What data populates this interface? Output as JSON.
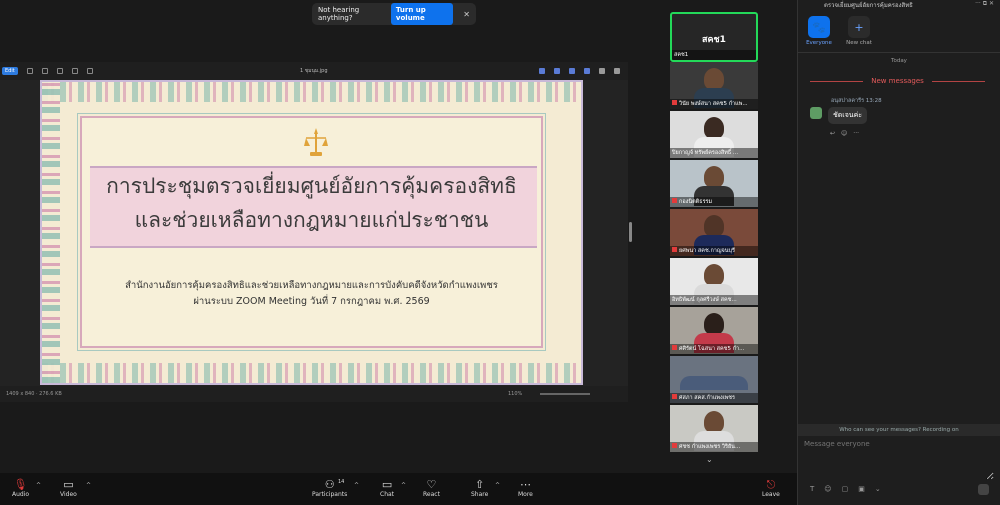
{
  "banner": {
    "text": "Not hearing anything?",
    "button": "Turn up volume"
  },
  "share": {
    "toolbar_edit": "Edit",
    "toolbar_title": "1 ชุมนุม.jpg",
    "status": "1409 x 840 · 276.6 KB",
    "zoom": "110%"
  },
  "slide": {
    "title_line1": "การประชุมตรวจเยี่ยมศูนย์อัยการคุ้มครองสิทธิ",
    "title_line2": "และช่วยเหลือทางกฎหมายแก่ประชาชน",
    "subtitle_line1": "สำนักงานอัยการคุ้มครองสิทธิและช่วยเหลือทางกฎหมายและการบังคับคดีจังหวัดกำแพงเพชร",
    "subtitle_line2": "ผ่านระบบ ZOOM  Meeting วันที่ 7 กรกฎาคม พ.ศ. 2569"
  },
  "participants": [
    {
      "big": "สคช1",
      "name": "สคช1",
      "active": true
    },
    {
      "name": "วินัย พงษ์สนา สคช5 กำแพ..."
    },
    {
      "name": "ปิยกาญจ์ ทรัพย์ครองสิทธิ์ ..."
    },
    {
      "name": "กองนิตติธรรม"
    },
    {
      "name": "ยศพนา สคช.กาญจนบุรี"
    },
    {
      "name": "อิทธิพัฒน์ กุลศรีวงษ์ สคช..."
    },
    {
      "name": "ศศิรัตน์ โฉสนา สคช5 กำ..."
    },
    {
      "name": "ศสภา สคส.กำแพงเพชร"
    },
    {
      "name": "ศชช กำแพงเพชร วิริยัน..."
    }
  ],
  "chat": {
    "title": "ตรวจเยี่ยมศูนย์อัยการคุ้มครองสิทธิ",
    "tabs": [
      {
        "label": "Everyone",
        "icon": "paw-icon"
      },
      {
        "label": "New chat",
        "icon": "plus-icon"
      }
    ],
    "today": "Today",
    "new_messages": "New messages",
    "message": {
      "sender": "อนุสปาลคารีร",
      "time": "13:28",
      "text": "ชัดเจนค่ะ"
    },
    "who_can_see": "Who can see your messages? Recording on",
    "input_placeholder": "Message everyone"
  },
  "toolbar": {
    "audio": "Audio",
    "video": "Video",
    "participants": "Participants",
    "participants_count": "14",
    "chat": "Chat",
    "react": "React",
    "share": "Share",
    "more": "More",
    "leave": "Leave"
  },
  "colors": {
    "accent": "#0e72ed",
    "active_border": "#23d959",
    "danger": "#e23b3b"
  }
}
